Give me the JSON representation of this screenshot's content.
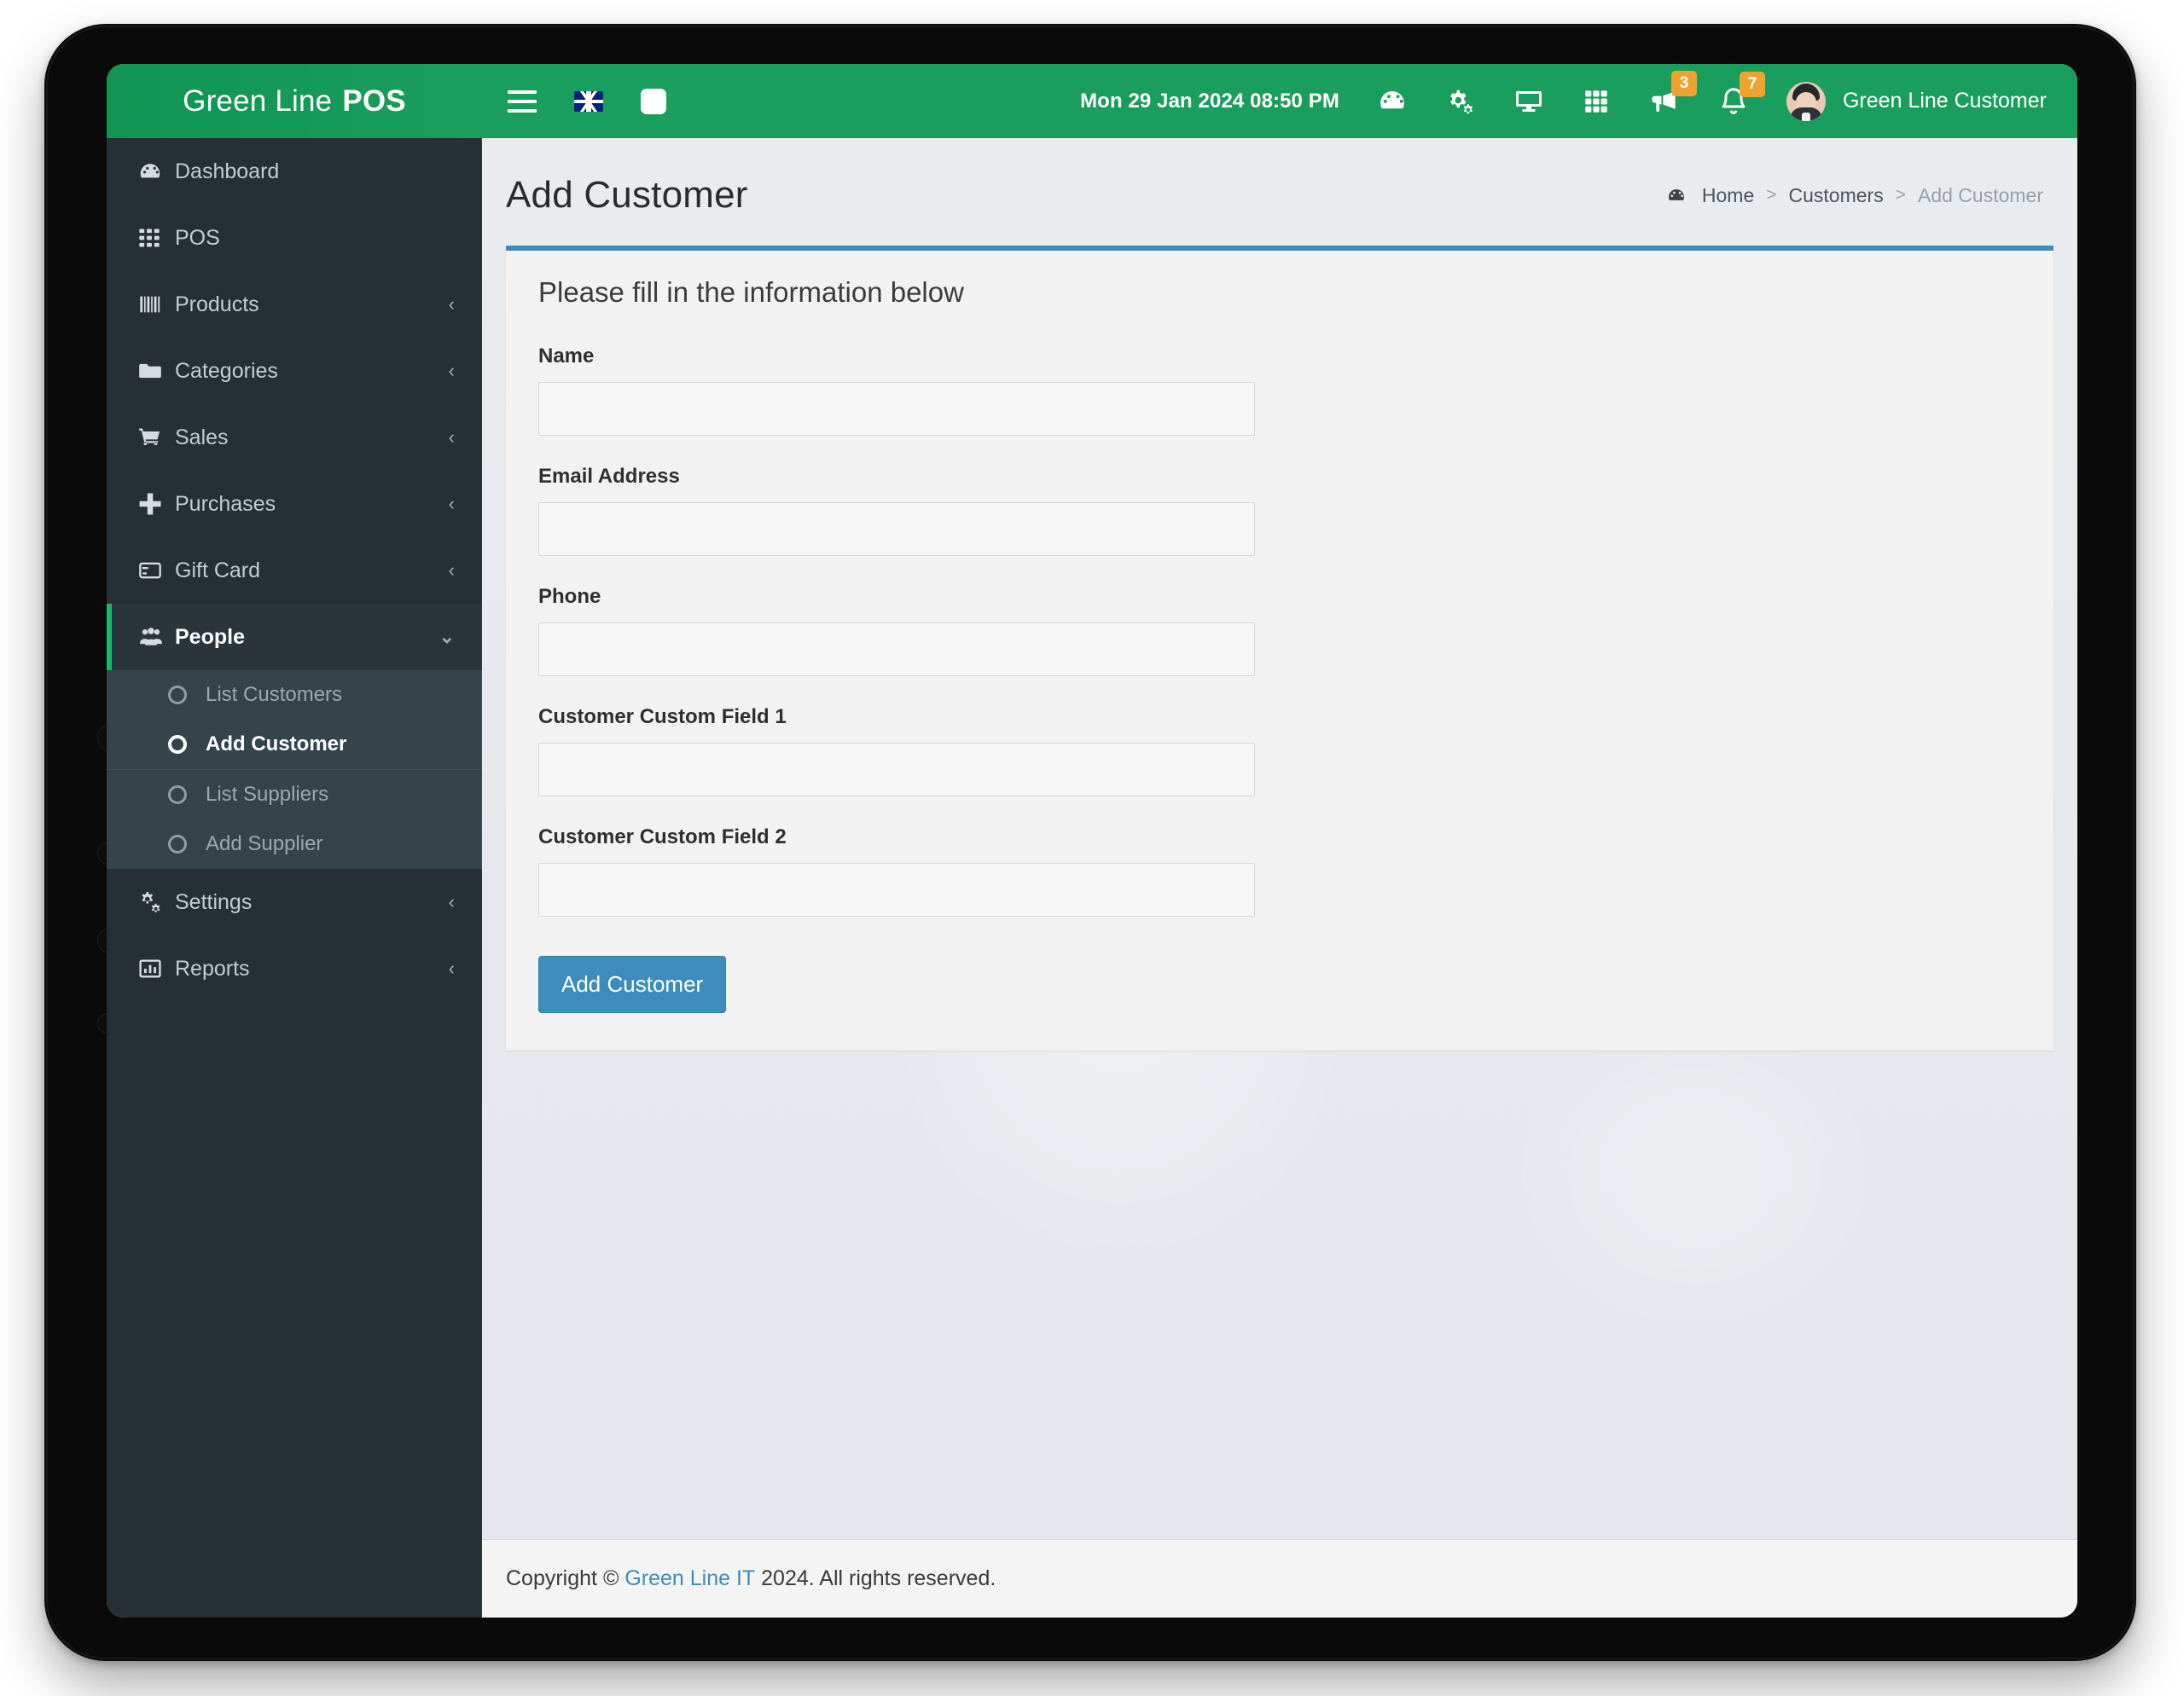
{
  "brand": {
    "word1": "Green Line",
    "word2": "POS"
  },
  "navbar": {
    "menu_toggle_icon": "hamburger-icon",
    "language_flag": "uk-flag-icon",
    "fullscreen_icon": "fullscreen-icon",
    "datetime": "Mon 29 Jan 2024 08:50 PM",
    "icons": [
      {
        "name": "dashboard-gauge-icon"
      },
      {
        "name": "settings-gears-icon"
      },
      {
        "name": "monitor-icon"
      },
      {
        "name": "apps-grid-icon"
      }
    ],
    "announcement_badge": "3",
    "notification_badge": "7",
    "user_name": "Green Line Customer"
  },
  "sidebar": {
    "items": [
      {
        "label": "Dashboard",
        "icon": "gauge-icon",
        "arrow": "",
        "active": false
      },
      {
        "label": "POS",
        "icon": "grid-icon",
        "arrow": "",
        "active": false
      },
      {
        "label": "Products",
        "icon": "barcode-icon",
        "arrow": "‹",
        "active": false
      },
      {
        "label": "Categories",
        "icon": "folder-icon",
        "arrow": "‹",
        "active": false
      },
      {
        "label": "Sales",
        "icon": "cart-icon",
        "arrow": "‹",
        "active": false
      },
      {
        "label": "Purchases",
        "icon": "plus-icon",
        "arrow": "‹",
        "active": false
      },
      {
        "label": "Gift Card",
        "icon": "credit-card-icon",
        "arrow": "‹",
        "active": false
      },
      {
        "label": "People",
        "icon": "users-icon",
        "arrow": "⌄",
        "active": true
      }
    ],
    "submenu_group_1": [
      {
        "label": "List Customers",
        "active": false
      },
      {
        "label": "Add Customer",
        "active": true
      }
    ],
    "submenu_group_2": [
      {
        "label": "List Suppliers",
        "active": false
      },
      {
        "label": "Add Supplier",
        "active": false
      }
    ],
    "items_after": [
      {
        "label": "Settings",
        "icon": "gears-icon",
        "arrow": "‹"
      },
      {
        "label": "Reports",
        "icon": "chart-icon",
        "arrow": "‹"
      }
    ]
  },
  "page": {
    "title": "Add Customer",
    "breadcrumb": {
      "home": "Home",
      "sep": ">",
      "parent": "Customers",
      "current": "Add Customer"
    }
  },
  "form": {
    "card_title": "Please fill in the information below",
    "fields": [
      {
        "label": "Name",
        "value": "",
        "placeholder": ""
      },
      {
        "label": "Email Address",
        "value": "",
        "placeholder": ""
      },
      {
        "label": "Phone",
        "value": "",
        "placeholder": ""
      },
      {
        "label": "Customer Custom Field 1",
        "value": "",
        "placeholder": ""
      },
      {
        "label": "Customer Custom Field 2",
        "value": "",
        "placeholder": ""
      }
    ],
    "submit_label": "Add Customer"
  },
  "footer": {
    "prefix": "Copyright ©",
    "link": "Green Line IT",
    "suffix": "2024. All rights reserved."
  },
  "colors": {
    "brand_green": "#1a9e5e",
    "sidebar_bg": "#262f33",
    "submenu_bg": "#34444a",
    "accent_blue": "#3c8dbc",
    "badge_orange": "#f0a22e",
    "active_green": "#19b96b"
  }
}
